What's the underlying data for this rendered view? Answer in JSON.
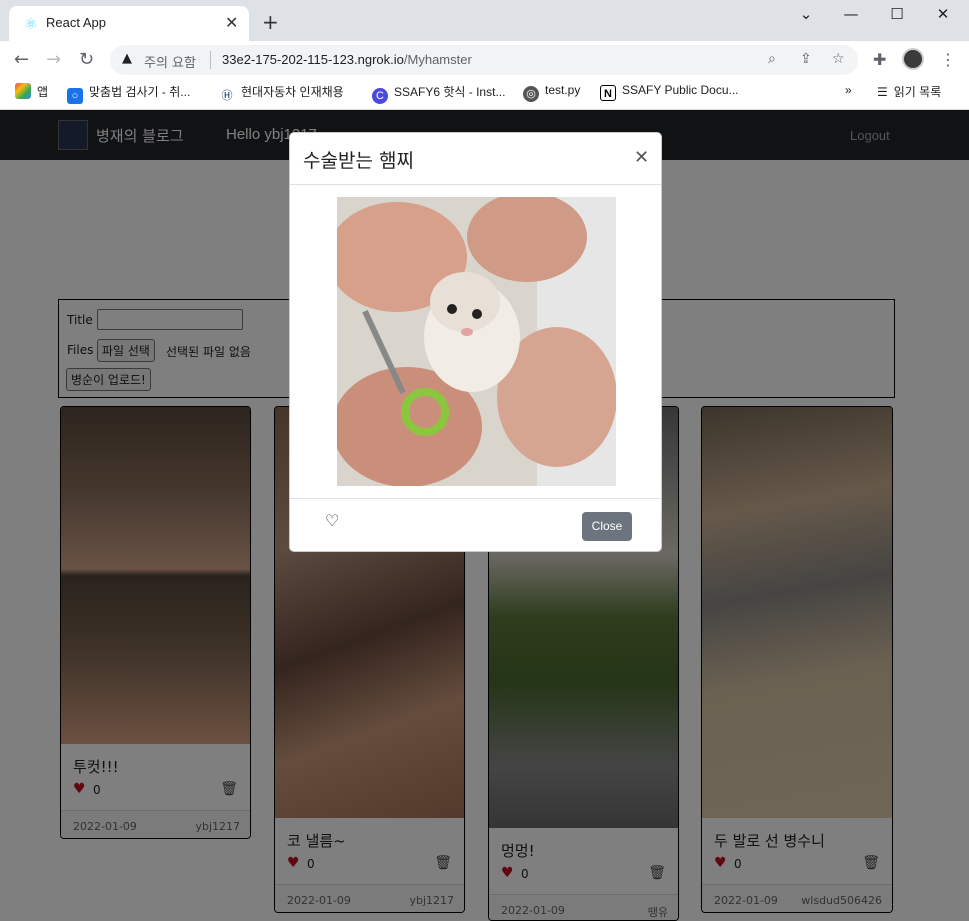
{
  "browser": {
    "tab_title": "React App",
    "security_label": "주의 요함",
    "url_host": "33e2-175-202-115-123.ngrok.io",
    "url_path": "/Myhamster",
    "bookmarks": [
      "앱",
      "맞춤법 검사기 - 취...",
      "현대자동차 인재채용",
      "SSAFY6 핫식 - Inst...",
      "test.py",
      "SSAFY Public Docu..."
    ],
    "reading_list": "읽기 목록"
  },
  "navbar": {
    "brand": "병재의 블로그",
    "greeting": "Hello ybj1217",
    "logout": "Logout"
  },
  "upload_form": {
    "title_label": "Title",
    "files_label": "Files",
    "file_button": "파일 선택",
    "file_status": "선택된 파일 없음",
    "submit_button": "병순이 업로드!"
  },
  "cards": [
    {
      "title": "투컷!!!",
      "likes": "0",
      "date": "2022-01-09",
      "user": "ybj1217"
    },
    {
      "title": "코 낼름~",
      "likes": "0",
      "date": "2022-01-09",
      "user": "ybj1217"
    },
    {
      "title": "멍멍!",
      "likes": "0",
      "date": "2022-01-09",
      "user": "땡유"
    },
    {
      "title": "두 발로 선 병수니",
      "likes": "0",
      "date": "2022-01-09",
      "user": "wlsdud506426"
    }
  ],
  "modal": {
    "title": "수술받는 햄찌",
    "close_button": "Close"
  },
  "colors": {
    "navbar": "#212529",
    "heart": "#c01020",
    "close_button": "#6c757d"
  }
}
